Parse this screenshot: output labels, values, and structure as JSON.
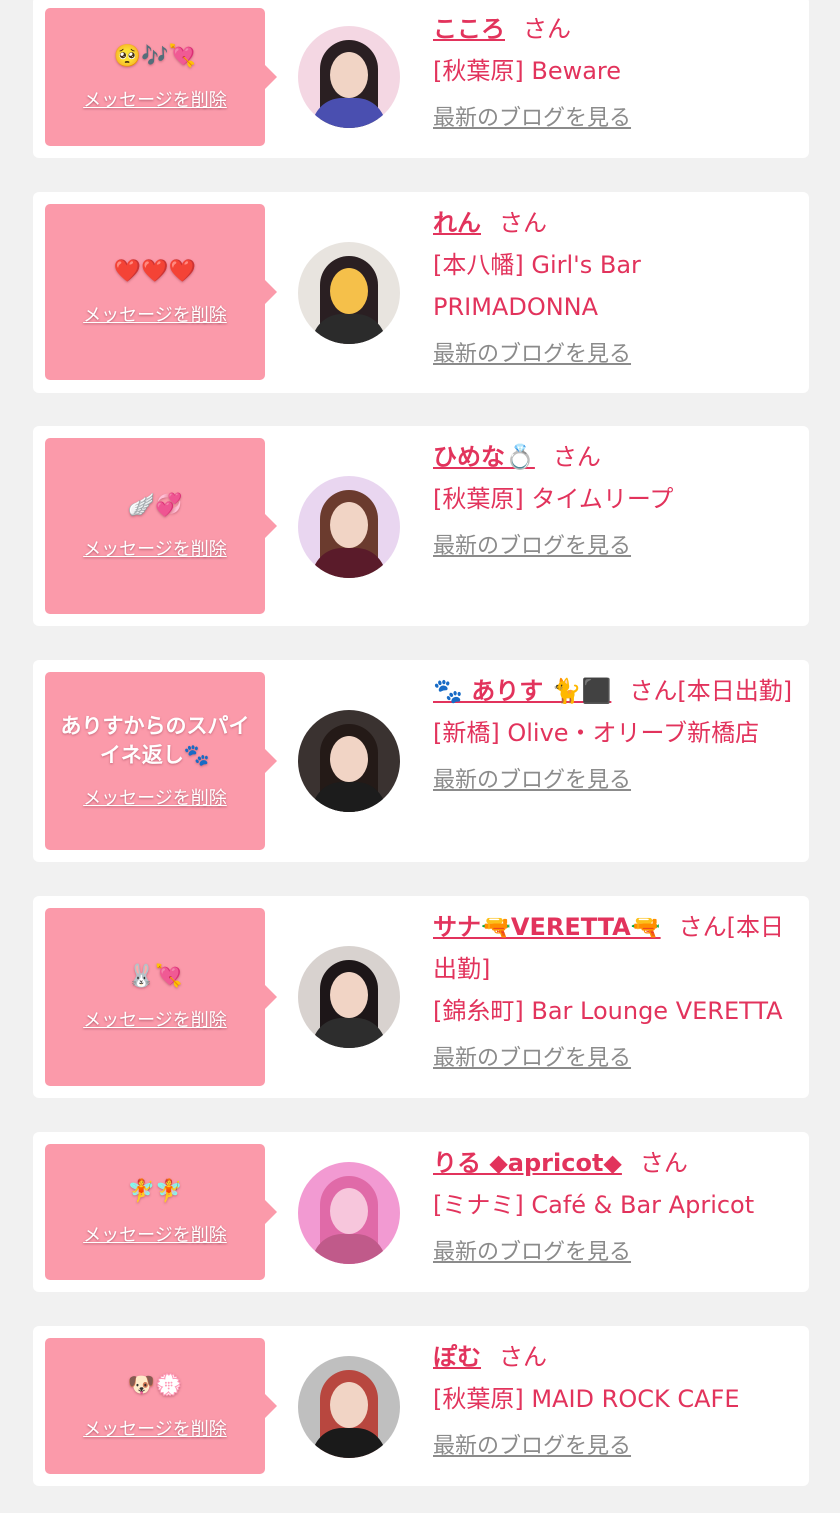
{
  "delete_label": "メッセージを削除",
  "san_label": "さん",
  "blog_label": "最新のブログを見る",
  "colors": {
    "bubble": "#fb9aaa",
    "accent": "#e2335c",
    "link_gray": "#8b8b8b",
    "background": "#f1f1f1"
  },
  "cards": [
    {
      "message": "🥺🎶💘",
      "name": "こころ",
      "suffix": "",
      "shop": "[秋葉原] Beware"
    },
    {
      "message": "❤️❤️❤️",
      "name": "れん",
      "suffix": "",
      "shop": "[本八幡] Girl's Bar PRIMADONNA"
    },
    {
      "message": "🪽💞",
      "name": "ひめな💍",
      "suffix": "",
      "shop": "[秋葉原] タイムリープ"
    },
    {
      "message": "ありすからのスパイイネ返し🐾",
      "name": "🐾 ありす 🐈⬛",
      "suffix": "[本日出勤]",
      "shop": "[新橋] Olive・オリーブ新橋店"
    },
    {
      "message": "🐰💘",
      "name": "サナ🔫VERETTA🔫",
      "suffix": "[本日出勤]",
      "shop": "[錦糸町] Bar Lounge VERETTA"
    },
    {
      "message": "🧚🧚",
      "name": "りる ◆apricot◆",
      "suffix": "",
      "shop": "[ミナミ] Café & Bar Apricot"
    },
    {
      "message": "🐶💮",
      "name": "ぽむ",
      "suffix": "",
      "shop": "[秋葉原] MAID ROCK CAFE"
    }
  ]
}
